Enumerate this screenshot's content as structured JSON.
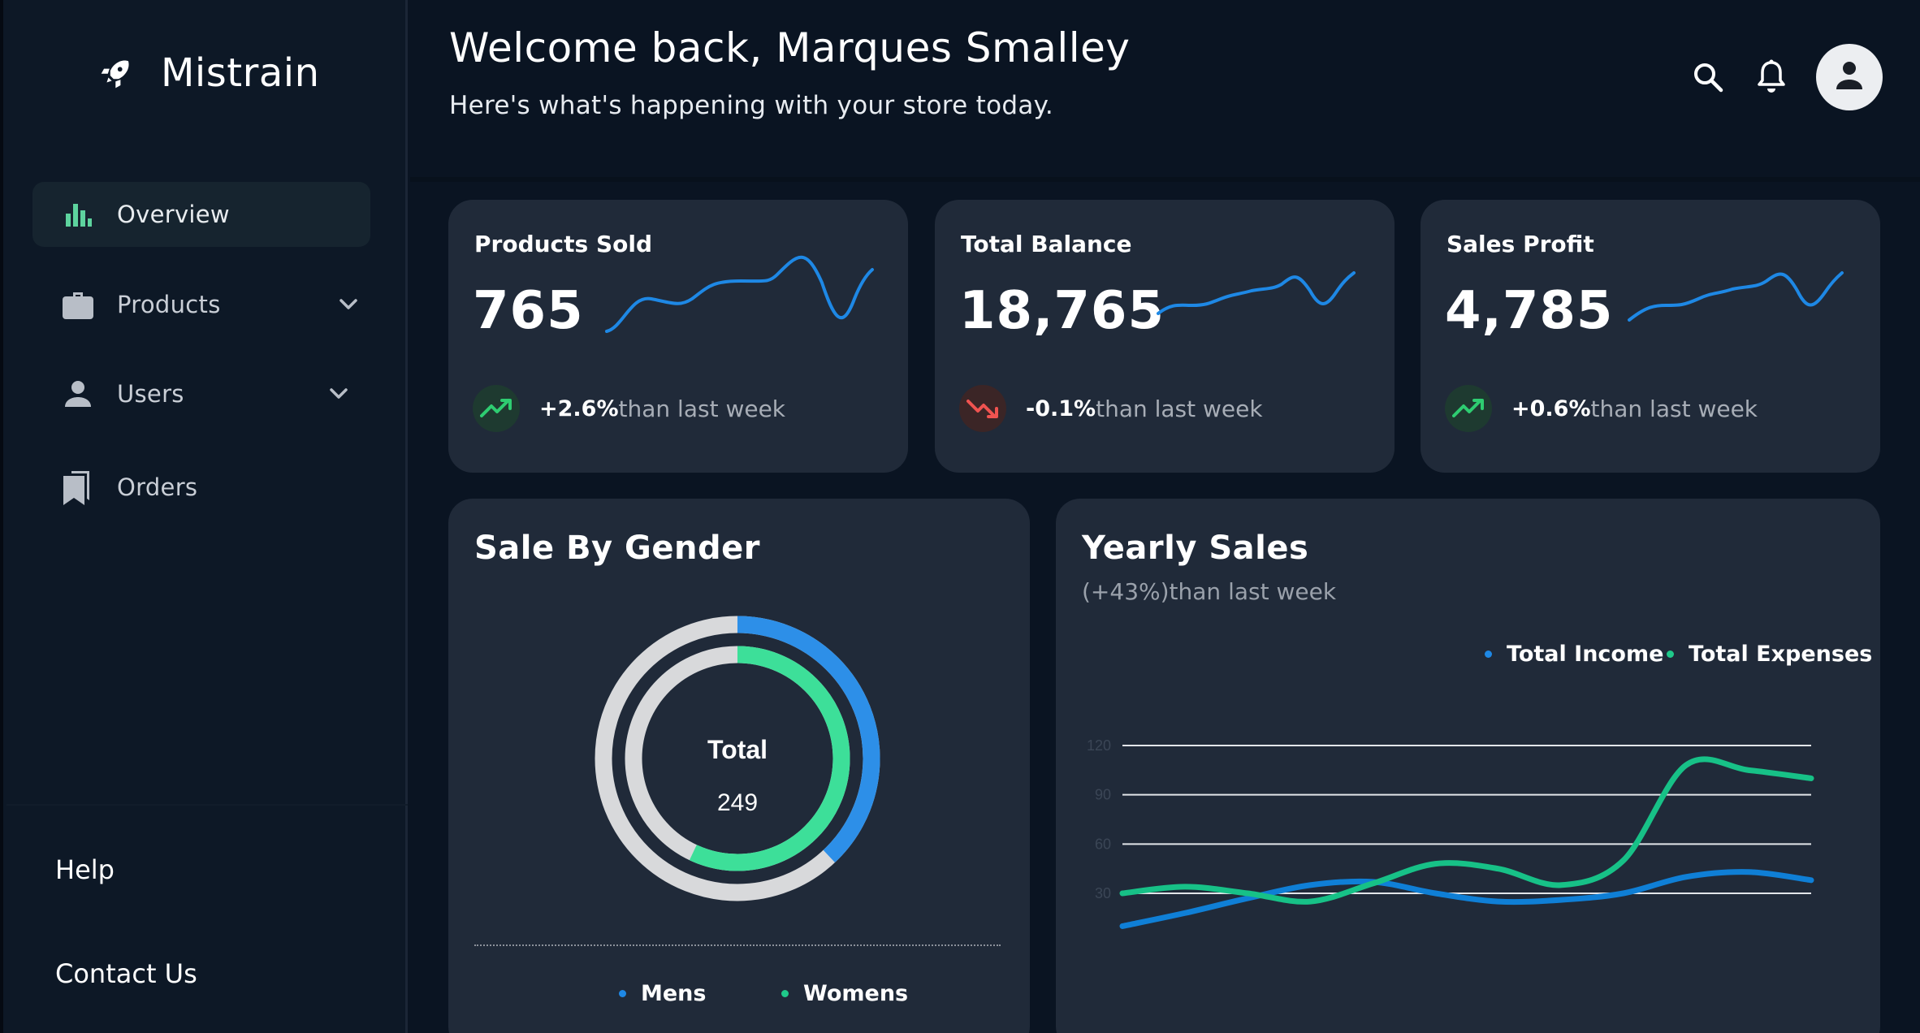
{
  "brand": {
    "name": "Mistrain"
  },
  "sidebar": {
    "items": [
      {
        "label": "Overview",
        "active": true
      },
      {
        "label": "Products",
        "has_dropdown": true
      },
      {
        "label": "Users",
        "has_dropdown": true
      },
      {
        "label": "Orders"
      }
    ],
    "footer": {
      "help": "Help",
      "contact": "Contact Us"
    }
  },
  "header": {
    "welcome": "Welcome back, Marques Smalley",
    "subtitle": "Here's what's happening with your store today."
  },
  "stats": [
    {
      "title": "Products Sold",
      "value": "765",
      "change": "+2.6%",
      "change_text": "than last week",
      "direction": "up"
    },
    {
      "title": "Total Balance",
      "value": "18,765",
      "change": "-0.1%",
      "change_text": "than last week",
      "direction": "down"
    },
    {
      "title": "Sales Profit",
      "value": "4,785",
      "change": "+0.6%",
      "change_text": "than last week",
      "direction": "up"
    }
  ],
  "colors": {
    "accent_blue": "#1e88e5",
    "accent_green": "#1fc98a",
    "positive": "#2ecc71",
    "negative": "#ef5350"
  },
  "gender": {
    "title": "Sale By Gender",
    "center_label": "Total",
    "center_value": "249",
    "legend": [
      "Mens",
      "Womens"
    ]
  },
  "yearly": {
    "title": "Yearly Sales",
    "subtitle": "(+43%)than last week",
    "legend": [
      "Total Income",
      "Total Expenses"
    ]
  },
  "chart_data": [
    {
      "type": "pie",
      "title": "Sale By Gender",
      "categories": [
        "Mens",
        "Womens"
      ],
      "center_label": "Total",
      "center_total": 249,
      "rings": [
        {
          "name": "Mens",
          "fraction": 0.38,
          "color": "#2d8fe8"
        },
        {
          "name": "Womens",
          "fraction": 0.57,
          "color": "#3ddf99"
        }
      ]
    },
    {
      "type": "line",
      "title": "Yearly Sales",
      "ylim": [
        0,
        120
      ],
      "yticks": [
        30,
        60,
        90,
        120
      ],
      "grid": true,
      "legend_position": "top-right",
      "x": [
        0,
        1,
        2,
        3,
        4,
        5,
        6,
        7,
        8,
        9,
        10,
        11
      ],
      "series": [
        {
          "name": "Total Income",
          "color": "#0f7fd6",
          "values": [
            10,
            18,
            27,
            35,
            37,
            30,
            25,
            26,
            30,
            40,
            43,
            38
          ]
        },
        {
          "name": "Total Expenses",
          "color": "#17c187",
          "values": [
            30,
            34,
            30,
            25,
            36,
            48,
            45,
            35,
            50,
            108,
            105,
            100
          ]
        }
      ]
    }
  ]
}
